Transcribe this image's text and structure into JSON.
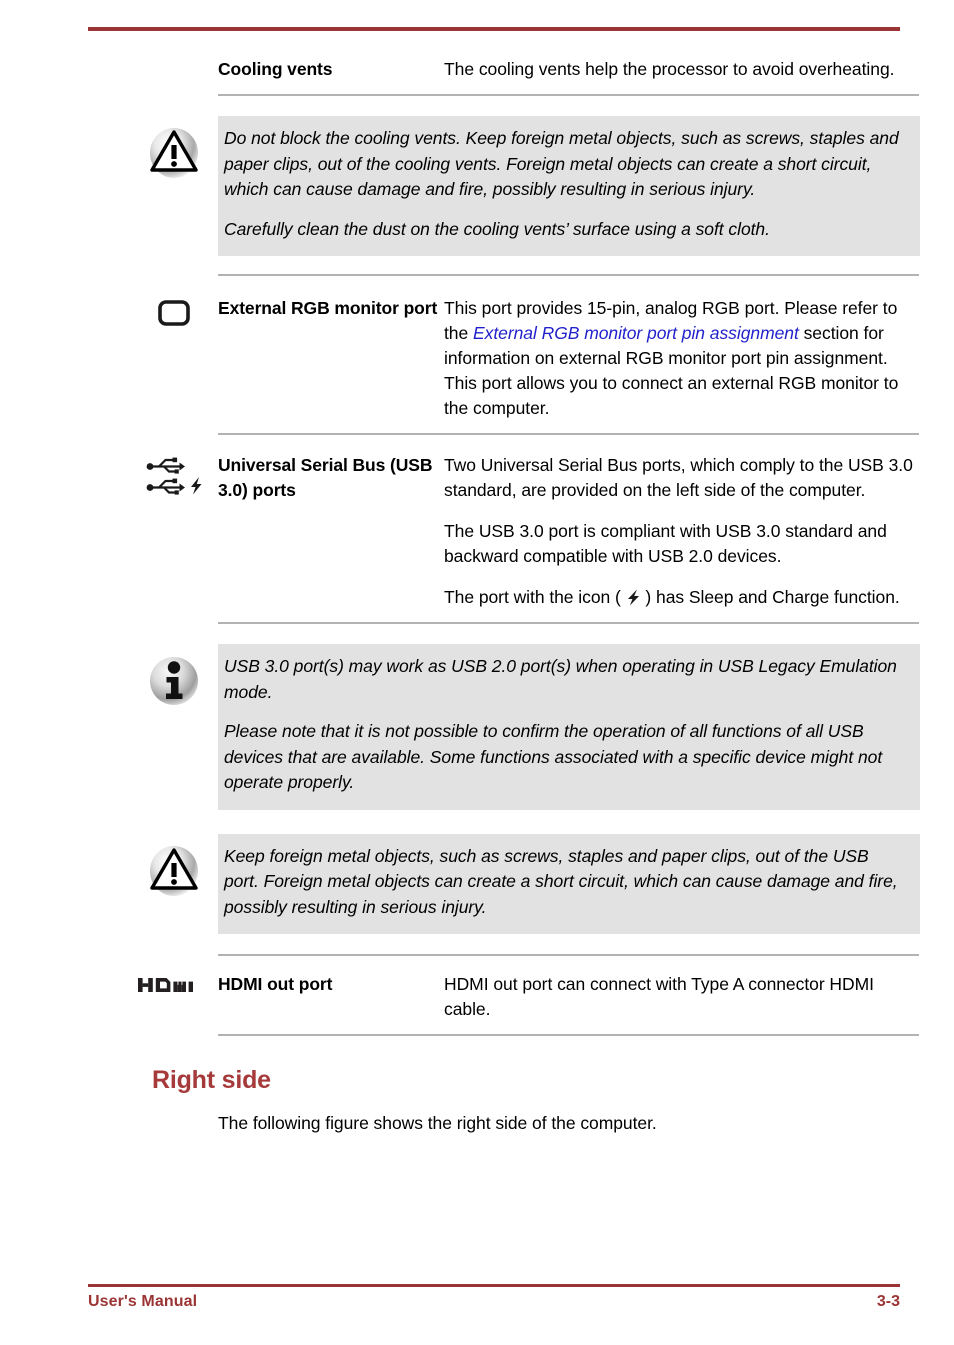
{
  "page": {
    "rule_color": "#9B3434",
    "heading_color": "#A63A3A",
    "link_color": "#2222CC",
    "callout_bg": "#E2E2E2"
  },
  "footer": {
    "left_label": "User's Manual",
    "page_number": "3-3"
  },
  "rows": [
    {
      "id": "cooling-vents",
      "icon": "none",
      "term": "Cooling vents",
      "paragraphs": [
        "The cooling vents help the processor to avoid overheating."
      ]
    },
    {
      "id": "external-rgb-monitor-port",
      "icon": "monitor-icon",
      "term": "External RGB monitor port",
      "desc_prefix": "This port provides 15-pin, analog RGB port. Please refer to the ",
      "desc_link": "External RGB monitor port pin assignment",
      "desc_suffix": " section for information on external RGB monitor port pin assignment. This port allows you to connect an external RGB monitor to the computer."
    },
    {
      "id": "usb-30-ports",
      "icon": "usb-icon",
      "term": "Universal Serial Bus (USB 3.0) ports",
      "paragraphs": [
        "Two Universal Serial Bus ports, which comply to the USB 3.0 standard, are provided on the left side of the computer.",
        "The USB 3.0 port is compliant with USB 3.0 standard and backward compatible with USB 2.0 devices.",
        "The port with the icon (  ) has Sleep and Charge function."
      ],
      "port_icon_before": "The port with the icon ( ",
      "port_icon_after": " ) has Sleep and Charge function."
    },
    {
      "id": "hdmi-out-port",
      "icon": "hdmi-logo-icon",
      "term": "HDMI out port",
      "paragraphs": [
        "HDMI out port can connect with Type A connector HDMI cable."
      ]
    }
  ],
  "callouts": [
    {
      "id": "cooling-vents-warning",
      "icon": "warning-icon",
      "paragraphs": [
        "Do not block the cooling vents. Keep foreign metal objects, such as screws, staples and paper clips, out of the cooling vents. Foreign metal objects can create a short circuit, which can cause damage and fire, possibly resulting in serious injury.",
        "Carefully clean the dust on the cooling vents’ surface using a soft cloth."
      ]
    },
    {
      "id": "usb-legacy-info",
      "icon": "info-icon",
      "paragraphs": [
        "USB 3.0 port(s) may work as USB 2.0 port(s) when operating in USB Legacy Emulation mode.",
        "Please note that it is not possible to confirm the operation of all functions of all USB devices that are available. Some functions associated with a specific device might not operate properly."
      ]
    },
    {
      "id": "usb-port-warning",
      "icon": "warning-icon",
      "paragraphs": [
        "Keep foreign metal objects, such as screws, staples and paper clips, out of the USB port. Foreign metal objects can create a short circuit, which can cause damage and fire, possibly resulting in serious injury."
      ]
    }
  ],
  "section": {
    "heading": "Right side",
    "paragraph": "The following figure shows the right side of the computer."
  }
}
